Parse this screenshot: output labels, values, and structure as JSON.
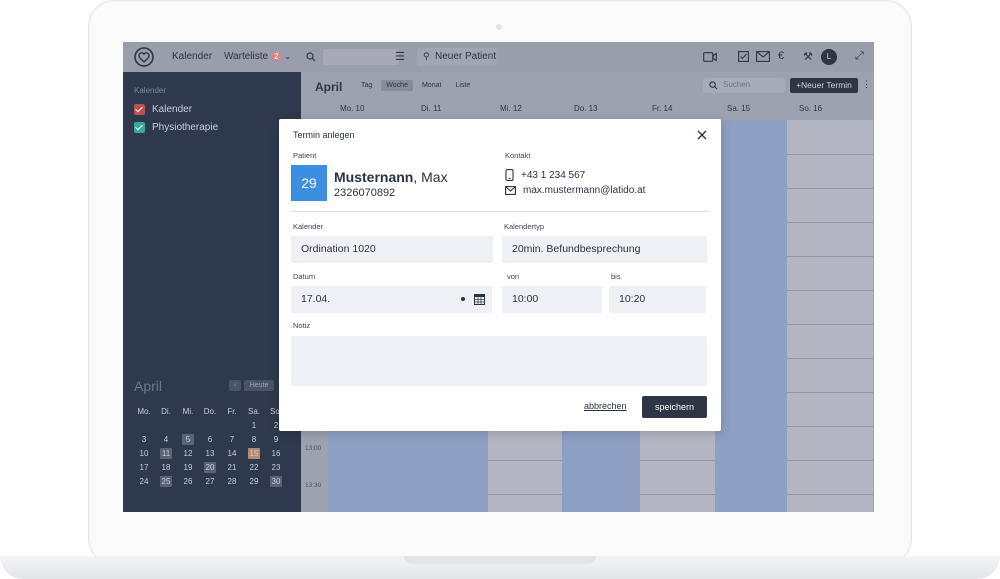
{
  "topbar": {
    "calendar_label": "Kalender",
    "waitlist_label": "Warteliste",
    "waitlist_count": "2",
    "new_patient_label": "Neuer Patient",
    "avatar_initial": "L"
  },
  "sidebar": {
    "heading": "Kalender",
    "calendars": [
      {
        "label": "Kalender",
        "color": "#c0504d"
      },
      {
        "label": "Physiotherapie",
        "color": "#3aa79b"
      }
    ],
    "mini_month": "April",
    "mini_nav_label": "Heute",
    "weekdays": [
      "Mo.",
      "Di.",
      "Mi.",
      "Do.",
      "Fr.",
      "Sa.",
      "So."
    ],
    "weeks": [
      [
        "",
        "",
        "",
        "",
        "",
        "1",
        "2"
      ],
      [
        "3",
        "4",
        "5",
        "6",
        "7",
        "8",
        "9"
      ],
      [
        "10",
        "11",
        "12",
        "13",
        "14",
        "15",
        "16"
      ],
      [
        "17",
        "18",
        "19",
        "20",
        "21",
        "22",
        "23"
      ],
      [
        "24",
        "25",
        "26",
        "27",
        "28",
        "29",
        "30"
      ]
    ]
  },
  "calendar": {
    "month": "April",
    "views": [
      "Tag",
      "Woche",
      "Monat",
      "Liste"
    ],
    "active_view": "Woche",
    "search_placeholder": "Suchen",
    "new_appointment_label": "+Neuer Termin",
    "days": [
      "Mo. 10",
      "Di. 11",
      "Mi. 12",
      "Do. 13",
      "Fr. 14",
      "Sa. 15",
      "So. 16"
    ],
    "times": [
      "13:00",
      "13:30"
    ]
  },
  "dialog": {
    "title": "Termin anlegen",
    "patient_label": "Patient",
    "patient_day": "29",
    "patient_lastname": "Musternann",
    "patient_firstname": ", Max",
    "patient_id": "2326070892",
    "contact_label": "Kontakt",
    "phone": "+43 1 234 567",
    "email": "max.mustermann@latido.at",
    "calendar_label": "Kalender",
    "calendar_value": "Ordination 1020",
    "type_label": "Kalendertyp",
    "type_value": "20min. Befundbesprechung",
    "date_label": "Datum",
    "date_value": "17.04.",
    "from_label": "von",
    "from_value": "10:00",
    "to_label": "bis",
    "to_value": "10:20",
    "note_label": "Notiz",
    "note_value": "",
    "cancel_label": "abbrechen",
    "save_label": "speichern"
  }
}
